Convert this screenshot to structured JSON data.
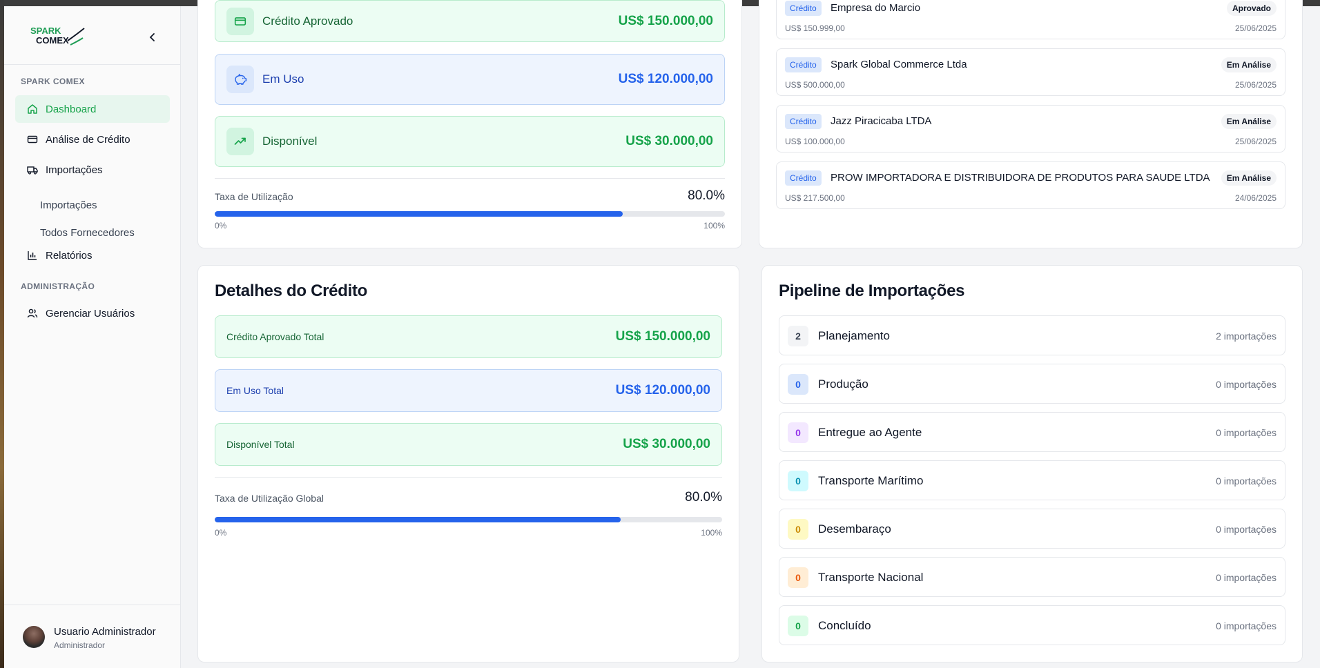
{
  "sidebar": {
    "brand_top": "SPARK",
    "brand_bottom": "COMEX",
    "section_main": "SPARK COMEX",
    "section_admin": "ADMINISTRAÇÃO",
    "items": {
      "dashboard": "Dashboard",
      "credit_analysis": "Análise de Crédito",
      "imports": "Importações",
      "imports_sub": "Importações",
      "suppliers_sub": "Todos Fornecedores",
      "reports": "Relatórios",
      "manage_users": "Gerenciar Usuários"
    },
    "user": {
      "name": "Usuario Administrador",
      "role": "Administrador"
    }
  },
  "overview": {
    "approved": {
      "label": "Crédito Aprovado",
      "value": "US$ 150.000,00"
    },
    "in_use": {
      "label": "Em Uso",
      "value": "US$ 120.000,00"
    },
    "available": {
      "label": "Disponível",
      "value": "US$ 30.000,00"
    },
    "utilization": {
      "label": "Taxa de Utilização",
      "value": "80.0%",
      "fraction": 0.8,
      "min": "0%",
      "max": "100%"
    }
  },
  "credit_requests": [
    {
      "tag": "Crédito",
      "company": "Empresa do Marcio",
      "amount": "US$ 150.999,00",
      "status": "Aprovado",
      "date": "25/06/2025"
    },
    {
      "tag": "Crédito",
      "company": "Spark Global Commerce Ltda",
      "amount": "US$ 500.000,00",
      "status": "Em Análise",
      "date": "25/06/2025"
    },
    {
      "tag": "Crédito",
      "company": "Jazz Piracicaba LTDA",
      "amount": "US$ 100.000,00",
      "status": "Em Análise",
      "date": "25/06/2025"
    },
    {
      "tag": "Crédito",
      "company": "PROW IMPORTADORA E DISTRIBUIDORA DE PRODUTOS PARA SAUDE LTDA",
      "amount": "US$ 217.500,00",
      "status": "Em Análise",
      "date": "24/06/2025"
    }
  ],
  "credit_details": {
    "title": "Detalhes do Crédito",
    "approved_total": {
      "label": "Crédito Aprovado Total",
      "value": "US$ 150.000,00"
    },
    "in_use_total": {
      "label": "Em Uso Total",
      "value": "US$ 120.000,00"
    },
    "available_total": {
      "label": "Disponível Total",
      "value": "US$ 30.000,00"
    },
    "utilization": {
      "label": "Taxa de Utilização Global",
      "value": "80.0%",
      "fraction": 0.8,
      "min": "0%",
      "max": "100%"
    }
  },
  "pipeline": {
    "title": "Pipeline de Importações",
    "stages": [
      {
        "count": "2",
        "name": "Planejamento",
        "text": "2 importações",
        "bg": "#f3f4f6",
        "fg": "#374151"
      },
      {
        "count": "0",
        "name": "Produção",
        "text": "0 importações",
        "bg": "#dbe7fb",
        "fg": "#2563eb"
      },
      {
        "count": "0",
        "name": "Entregue ao Agente",
        "text": "0 importações",
        "bg": "#f3e8ff",
        "fg": "#9333ea"
      },
      {
        "count": "0",
        "name": "Transporte Marítimo",
        "text": "0 importações",
        "bg": "#cffafe",
        "fg": "#0891b2"
      },
      {
        "count": "0",
        "name": "Desembaraço",
        "text": "0 importações",
        "bg": "#fef9c3",
        "fg": "#ca8a04"
      },
      {
        "count": "0",
        "name": "Transporte Nacional",
        "text": "0 importações",
        "bg": "#ffedd5",
        "fg": "#ea580c"
      },
      {
        "count": "0",
        "name": "Concluído",
        "text": "0 importações",
        "bg": "#dcfce7",
        "fg": "#16a34a"
      }
    ]
  },
  "colors": {
    "accent_green": "#16a34a",
    "accent_blue": "#2563eb"
  }
}
